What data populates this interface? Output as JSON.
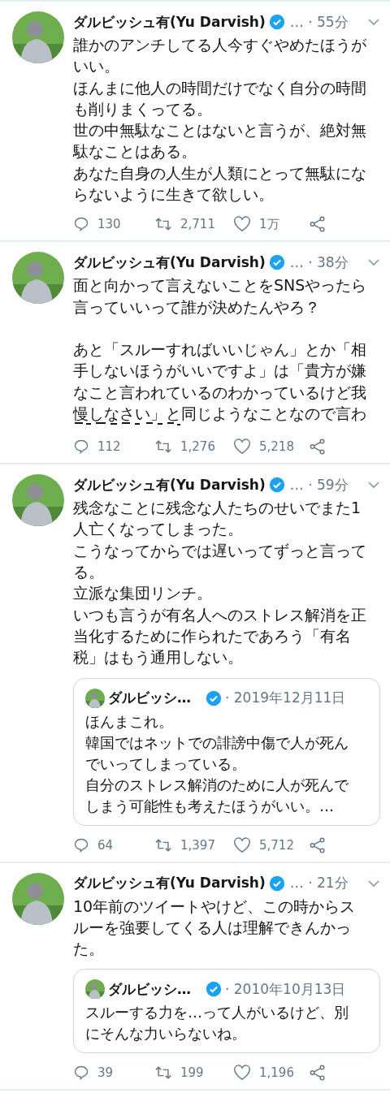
{
  "tweets": [
    {
      "author": "ダルビッシュ有(Yu Darvish)",
      "verified": true,
      "meta": "… · 55分",
      "blocks": [
        [
          "誰かのアンチしてる人今すぐやめたほうがいい。",
          "ほんまに他人の時間だけでなく自分の時間も削りまくってる。",
          "世の中無駄なことはないと言うが、絶対無駄なことはある。",
          "あなた自身の人生が人類にとって無駄にならないように生きて欲しい。"
        ]
      ],
      "stats": {
        "replies": "130",
        "retweets": "2,711",
        "likes": "1万"
      }
    },
    {
      "author": "ダルビッシュ有(Yu Darvish)",
      "verified": true,
      "meta": "… · 38分",
      "blocks": [
        [
          "面と向かって言えないことをSNSやったら言っていいって誰が決めたんやろ？"
        ],
        [
          "あと「スルーすればいいじゃん」とか「相手しないほうがいいですよ」は「貴方が嫌なこと言われているのわかっているけど我慢しなさい」と同じようなことなので言わ"
        ]
      ],
      "cut": true,
      "stats": {
        "replies": "112",
        "retweets": "1,276",
        "likes": "5,218"
      }
    },
    {
      "author": "ダルビッシュ有(Yu Darvish)",
      "verified": true,
      "meta": "… · 59分",
      "blocks": [
        [
          "残念なことに残念な人たちのせいでまた1人亡くなってしまった。",
          "こうなってからでは遅いってずっと言ってる。",
          "立派な集団リンチ。",
          "いつも言うが有名人へのストレス解消を正当化するために作られたであろう「有名税」はもう通用しない。"
        ]
      ],
      "quote": {
        "author": "ダルビッシ…",
        "verified": true,
        "date": "· 2019年12月11日",
        "lines": [
          "ほんまこれ。",
          "韓国ではネットでの誹謗中傷で人が死んでいってしまっている。",
          "自分のストレス解消のために人が死んでしまう可能性も考えたほうがいい。…"
        ]
      },
      "stats": {
        "replies": "64",
        "retweets": "1,397",
        "likes": "5,712"
      }
    },
    {
      "author": "ダルビッシュ有(Yu Darvish)",
      "verified": true,
      "meta": "… · 21分",
      "blocks": [
        [
          "10年前のツイートやけど、この時からスルーを強要してくる人は理解できんかった。"
        ]
      ],
      "quote": {
        "author": "ダルビッシ…",
        "verified": true,
        "date": "· 2010年10月13日",
        "lines": [
          "スルーする力を…って人がいるけど、別にそんな力いらないね。"
        ]
      },
      "stats": {
        "replies": "39",
        "retweets": "199",
        "likes": "1,196"
      }
    }
  ]
}
